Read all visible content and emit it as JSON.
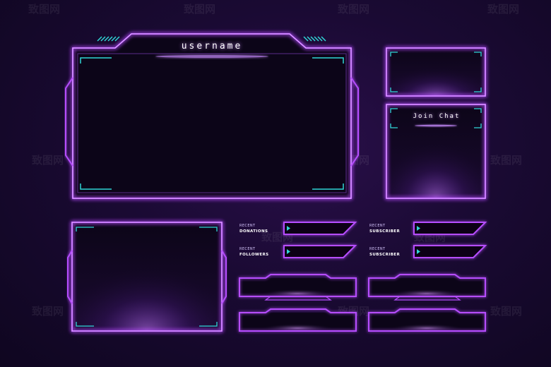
{
  "overlay": {
    "username": "username",
    "chat_title": "Join Chat",
    "labels": [
      {
        "top": "RECENT",
        "bottom": "DONATIONS"
      },
      {
        "top": "RECENT",
        "bottom": "FOLLOWERS"
      },
      {
        "top": "RECENT",
        "bottom": "SUBSCRIBER"
      },
      {
        "top": "RECENT",
        "bottom": "SUBSCRIBER"
      }
    ]
  },
  "watermark": {
    "text": "致图网"
  },
  "colors": {
    "neon": "#b64dff",
    "accent": "#2fd6d6",
    "bg": "#1a0a33"
  }
}
